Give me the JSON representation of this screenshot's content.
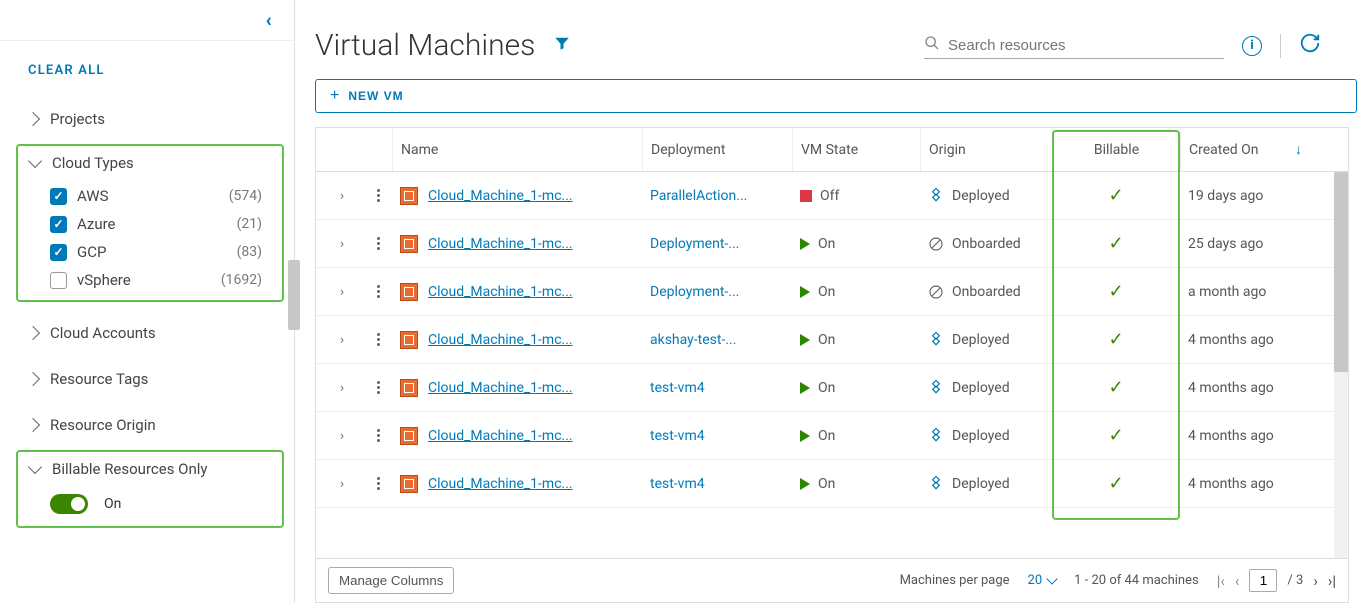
{
  "sidebar": {
    "clear_all": "CLEAR ALL",
    "groups": {
      "projects": {
        "label": "Projects"
      },
      "cloud_types": {
        "label": "Cloud Types",
        "items": [
          {
            "label": "AWS",
            "count": "(574)",
            "checked": true
          },
          {
            "label": "Azure",
            "count": "(21)",
            "checked": true
          },
          {
            "label": "GCP",
            "count": "(83)",
            "checked": true
          },
          {
            "label": "vSphere",
            "count": "(1692)",
            "checked": false
          }
        ]
      },
      "cloud_accounts": {
        "label": "Cloud Accounts"
      },
      "resource_tags": {
        "label": "Resource Tags"
      },
      "resource_origin": {
        "label": "Resource Origin"
      },
      "billable": {
        "label": "Billable Resources Only",
        "toggle_label": "On"
      }
    }
  },
  "header": {
    "title": "Virtual Machines",
    "search_placeholder": "Search resources",
    "new_vm": "NEW VM"
  },
  "table": {
    "columns": {
      "name": "Name",
      "deployment": "Deployment",
      "vm_state": "VM State",
      "origin": "Origin",
      "billable": "Billable",
      "created_on": "Created On"
    },
    "rows": [
      {
        "name": "Cloud_Machine_1-mc...",
        "deployment": "ParallelAction...",
        "state": "Off",
        "state_kind": "off",
        "origin": "Deployed",
        "origin_kind": "deployed",
        "billable": true,
        "created": "19 days ago"
      },
      {
        "name": "Cloud_Machine_1-mc...",
        "deployment": "Deployment-...",
        "state": "On",
        "state_kind": "on",
        "origin": "Onboarded",
        "origin_kind": "onboarded",
        "billable": true,
        "created": "25 days ago"
      },
      {
        "name": "Cloud_Machine_1-mc...",
        "deployment": "Deployment-...",
        "state": "On",
        "state_kind": "on",
        "origin": "Onboarded",
        "origin_kind": "onboarded",
        "billable": true,
        "created": "a month ago"
      },
      {
        "name": "Cloud_Machine_1-mc...",
        "deployment": "akshay-test-...",
        "state": "On",
        "state_kind": "on",
        "origin": "Deployed",
        "origin_kind": "deployed",
        "billable": true,
        "created": "4 months ago"
      },
      {
        "name": "Cloud_Machine_1-mc...",
        "deployment": "test-vm4",
        "state": "On",
        "state_kind": "on",
        "origin": "Deployed",
        "origin_kind": "deployed",
        "billable": true,
        "created": "4 months ago"
      },
      {
        "name": "Cloud_Machine_1-mc...",
        "deployment": "test-vm4",
        "state": "On",
        "state_kind": "on",
        "origin": "Deployed",
        "origin_kind": "deployed",
        "billable": true,
        "created": "4 months ago"
      },
      {
        "name": "Cloud_Machine_1-mc...",
        "deployment": "test-vm4",
        "state": "On",
        "state_kind": "on",
        "origin": "Deployed",
        "origin_kind": "deployed",
        "billable": true,
        "created": "4 months ago"
      }
    ]
  },
  "footer": {
    "manage_columns": "Manage Columns",
    "per_page_label": "Machines per page",
    "per_page_value": "20",
    "range_text": "1 - 20 of 44 machines",
    "page_current": "1",
    "page_total": "/ 3"
  }
}
